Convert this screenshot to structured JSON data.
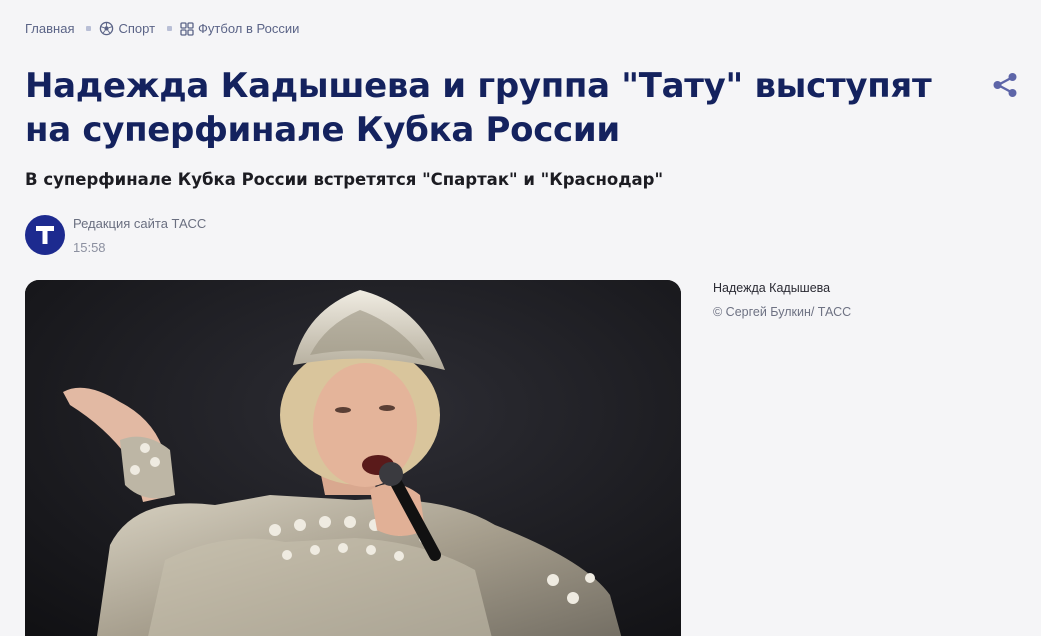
{
  "breadcrumb": {
    "home": "Главная",
    "section": "Спорт",
    "subsection": "Футбол в России"
  },
  "article": {
    "title": "Надежда Кадышева и группа \"Тату\" выступят на суперфинале Кубка России",
    "subtitle": "В суперфинале Кубка России встретятся \"Спартак\" и \"Краснодар\""
  },
  "author": {
    "logo_letter": "Т",
    "name": "Редакция сайта ТАСС",
    "time": "15:58"
  },
  "photo": {
    "caption": "Надежда Кадышева",
    "credit": "© Сергей Булкин/ ТАСС"
  },
  "colors": {
    "title": "#14225e",
    "accent": "#1d2a8f",
    "share": "#5d65a8"
  },
  "icons": {
    "sport": "soccer-ball-icon",
    "category": "grid-icon",
    "share": "share-icon"
  }
}
